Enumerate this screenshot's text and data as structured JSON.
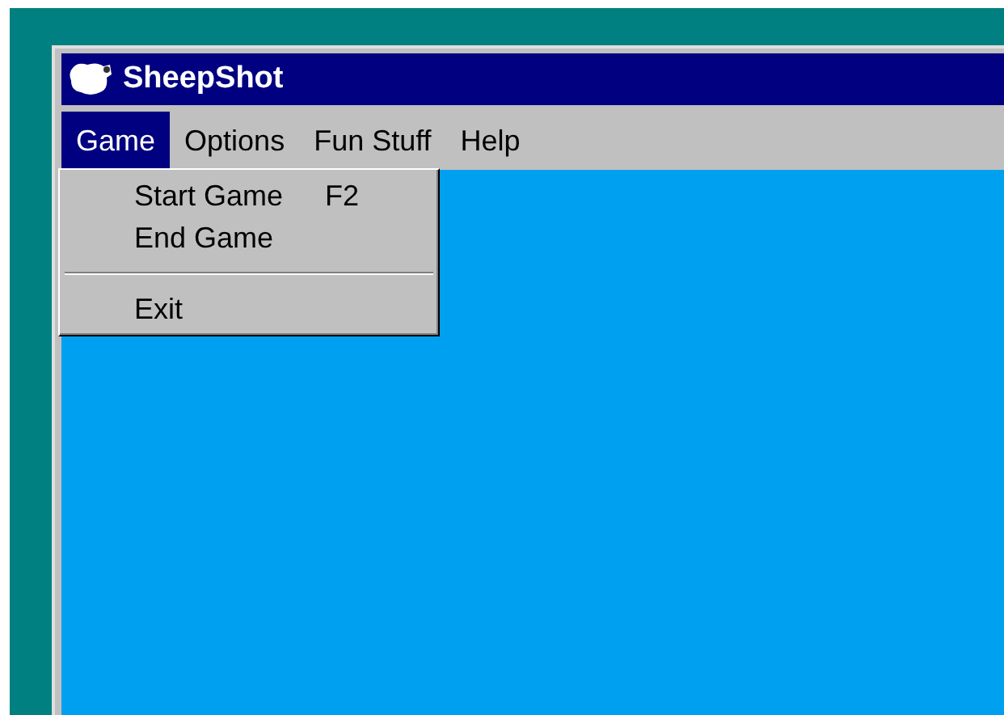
{
  "window": {
    "title": "SheepShot"
  },
  "menubar": [
    {
      "label": "Game",
      "selected": true
    },
    {
      "label": "Options",
      "selected": false
    },
    {
      "label": "Fun Stuff",
      "selected": false
    },
    {
      "label": "Help",
      "selected": false
    }
  ],
  "menu": [
    {
      "kind": "item",
      "label": "Start Game",
      "shortcut": "F2"
    },
    {
      "kind": "item",
      "label": "End Game"
    },
    {
      "kind": "separator"
    },
    {
      "kind": "item",
      "label": "Exit"
    }
  ]
}
